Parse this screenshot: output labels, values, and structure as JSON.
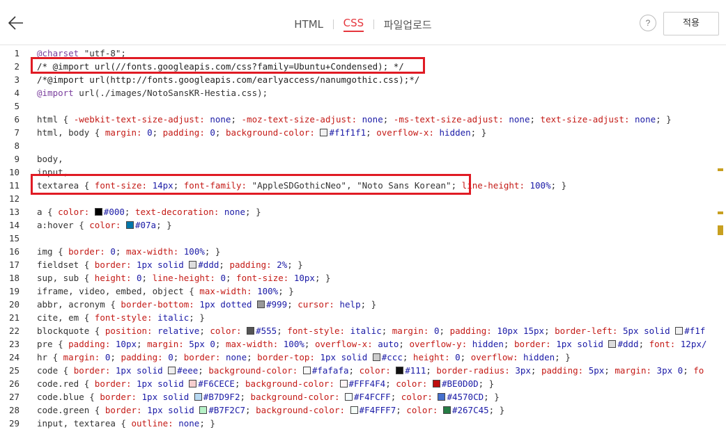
{
  "header": {
    "tabs": [
      {
        "label": "HTML",
        "active": false
      },
      {
        "label": "CSS",
        "active": true
      },
      {
        "label": "파일업로드",
        "active": false
      }
    ],
    "help_label": "?",
    "apply_label": "적용",
    "accent_color": "#e5363d"
  },
  "editor": {
    "lines": [
      {
        "n": "1",
        "segs": [
          [
            "at",
            "@charset "
          ],
          [
            "str",
            "\"utf-8\";"
          ]
        ]
      },
      {
        "n": "2",
        "segs": [
          [
            "cm",
            "/* @import url(//fonts.googleapis.com/css?family=Ubuntu+Condensed); */"
          ]
        ]
      },
      {
        "n": "3",
        "segs": [
          [
            "cm",
            "/*@import url(http://fonts.googleapis.com/earlyaccess/nanumgothic.css);*/"
          ]
        ]
      },
      {
        "n": "4",
        "segs": [
          [
            "at",
            "@import "
          ],
          [
            "sel",
            "url(./images/NotoSansKR-Hestia.css);"
          ]
        ]
      },
      {
        "n": "5",
        "segs": []
      },
      {
        "n": "6",
        "segs": [
          [
            "sel",
            "html { "
          ],
          [
            "prop",
            "-webkit-text-size-adjust: "
          ],
          [
            "val",
            "none"
          ],
          [
            "sel",
            "; "
          ],
          [
            "prop",
            "-moz-text-size-adjust: "
          ],
          [
            "val",
            "none"
          ],
          [
            "sel",
            "; "
          ],
          [
            "prop",
            "-ms-text-size-adjust: "
          ],
          [
            "val",
            "none"
          ],
          [
            "sel",
            "; "
          ],
          [
            "prop",
            "text-size-adjust: "
          ],
          [
            "val",
            "none"
          ],
          [
            "sel",
            "; }"
          ]
        ]
      },
      {
        "n": "7",
        "segs": [
          [
            "sel",
            "html, body { "
          ],
          [
            "prop",
            "margin: "
          ],
          [
            "val",
            "0"
          ],
          [
            "sel",
            "; "
          ],
          [
            "prop",
            "padding: "
          ],
          [
            "val",
            "0"
          ],
          [
            "sel",
            "; "
          ],
          [
            "prop",
            "background-color: "
          ],
          [
            "sw",
            "#f1f1f1"
          ],
          [
            "val",
            "#f1f1f1"
          ],
          [
            "sel",
            "; "
          ],
          [
            "prop",
            "overflow-x: "
          ],
          [
            "val",
            "hidden"
          ],
          [
            "sel",
            "; }"
          ]
        ]
      },
      {
        "n": "8",
        "segs": []
      },
      {
        "n": "9",
        "segs": [
          [
            "sel",
            "body,"
          ]
        ]
      },
      {
        "n": "10",
        "segs": [
          [
            "sel",
            "input,"
          ]
        ]
      },
      {
        "n": "11",
        "segs": [
          [
            "sel",
            "textarea { "
          ],
          [
            "prop",
            "font-size: "
          ],
          [
            "val",
            "14px"
          ],
          [
            "sel",
            "; "
          ],
          [
            "prop",
            "font-family: "
          ],
          [
            "str",
            "\"AppleSDGothicNeo\", \"Noto Sans Korean\""
          ],
          [
            "sel",
            "; "
          ],
          [
            "prop",
            "line-height: "
          ],
          [
            "val",
            "100%"
          ],
          [
            "sel",
            "; }"
          ]
        ]
      },
      {
        "n": "12",
        "segs": []
      },
      {
        "n": "13",
        "segs": [
          [
            "sel",
            "a { "
          ],
          [
            "prop",
            "color: "
          ],
          [
            "sw",
            "#000"
          ],
          [
            "val",
            "#000"
          ],
          [
            "sel",
            "; "
          ],
          [
            "prop",
            "text-decoration: "
          ],
          [
            "val",
            "none"
          ],
          [
            "sel",
            "; }"
          ]
        ]
      },
      {
        "n": "14",
        "segs": [
          [
            "sel",
            "a:hover { "
          ],
          [
            "prop",
            "color: "
          ],
          [
            "sw",
            "#07a"
          ],
          [
            "val",
            "#07a"
          ],
          [
            "sel",
            "; }"
          ]
        ]
      },
      {
        "n": "15",
        "segs": []
      },
      {
        "n": "16",
        "segs": [
          [
            "sel",
            "img { "
          ],
          [
            "prop",
            "border: "
          ],
          [
            "val",
            "0"
          ],
          [
            "sel",
            "; "
          ],
          [
            "prop",
            "max-width: "
          ],
          [
            "val",
            "100%"
          ],
          [
            "sel",
            "; }"
          ]
        ]
      },
      {
        "n": "17",
        "segs": [
          [
            "sel",
            "fieldset { "
          ],
          [
            "prop",
            "border: "
          ],
          [
            "val",
            "1px solid "
          ],
          [
            "sw",
            "#ddd"
          ],
          [
            "val",
            "#ddd"
          ],
          [
            "sel",
            "; "
          ],
          [
            "prop",
            "padding: "
          ],
          [
            "val",
            "2%"
          ],
          [
            "sel",
            "; }"
          ]
        ]
      },
      {
        "n": "18",
        "segs": [
          [
            "sel",
            "sup, sub { "
          ],
          [
            "prop",
            "height: "
          ],
          [
            "val",
            "0"
          ],
          [
            "sel",
            "; "
          ],
          [
            "prop",
            "line-height: "
          ],
          [
            "val",
            "0"
          ],
          [
            "sel",
            "; "
          ],
          [
            "prop",
            "font-size: "
          ],
          [
            "val",
            "10px"
          ],
          [
            "sel",
            "; }"
          ]
        ]
      },
      {
        "n": "19",
        "segs": [
          [
            "sel",
            "iframe, video, embed, object { "
          ],
          [
            "prop",
            "max-width: "
          ],
          [
            "val",
            "100%"
          ],
          [
            "sel",
            "; }"
          ]
        ]
      },
      {
        "n": "20",
        "segs": [
          [
            "sel",
            "abbr, acronym { "
          ],
          [
            "prop",
            "border-bottom: "
          ],
          [
            "val",
            "1px dotted "
          ],
          [
            "sw",
            "#999"
          ],
          [
            "val",
            "#999"
          ],
          [
            "sel",
            "; "
          ],
          [
            "prop",
            "cursor: "
          ],
          [
            "val",
            "help"
          ],
          [
            "sel",
            "; }"
          ]
        ]
      },
      {
        "n": "21",
        "segs": [
          [
            "sel",
            "cite, em { "
          ],
          [
            "prop",
            "font-style: "
          ],
          [
            "val",
            "italic"
          ],
          [
            "sel",
            "; }"
          ]
        ]
      },
      {
        "n": "22",
        "segs": [
          [
            "sel",
            "blockquote { "
          ],
          [
            "prop",
            "position: "
          ],
          [
            "val",
            "relative"
          ],
          [
            "sel",
            "; "
          ],
          [
            "prop",
            "color: "
          ],
          [
            "sw",
            "#555"
          ],
          [
            "val",
            "#555"
          ],
          [
            "sel",
            "; "
          ],
          [
            "prop",
            "font-style: "
          ],
          [
            "val",
            "italic"
          ],
          [
            "sel",
            "; "
          ],
          [
            "prop",
            "margin: "
          ],
          [
            "val",
            "0"
          ],
          [
            "sel",
            "; "
          ],
          [
            "prop",
            "padding: "
          ],
          [
            "val",
            "10px 15px"
          ],
          [
            "sel",
            "; "
          ],
          [
            "prop",
            "border-left: "
          ],
          [
            "val",
            "5px solid "
          ],
          [
            "sw",
            "#f1f1f1"
          ],
          [
            "val",
            "#f1f"
          ]
        ]
      },
      {
        "n": "23",
        "segs": [
          [
            "sel",
            "pre { "
          ],
          [
            "prop",
            "padding: "
          ],
          [
            "val",
            "10px"
          ],
          [
            "sel",
            "; "
          ],
          [
            "prop",
            "margin: "
          ],
          [
            "val",
            "5px 0"
          ],
          [
            "sel",
            "; "
          ],
          [
            "prop",
            "max-width: "
          ],
          [
            "val",
            "100%"
          ],
          [
            "sel",
            "; "
          ],
          [
            "prop",
            "overflow-x: "
          ],
          [
            "val",
            "auto"
          ],
          [
            "sel",
            "; "
          ],
          [
            "prop",
            "overflow-y: "
          ],
          [
            "val",
            "hidden"
          ],
          [
            "sel",
            "; "
          ],
          [
            "prop",
            "border: "
          ],
          [
            "val",
            "1px solid "
          ],
          [
            "sw",
            "#ddd"
          ],
          [
            "val",
            "#ddd"
          ],
          [
            "sel",
            "; "
          ],
          [
            "prop",
            "font: "
          ],
          [
            "val",
            "12px/"
          ]
        ]
      },
      {
        "n": "24",
        "segs": [
          [
            "sel",
            "hr { "
          ],
          [
            "prop",
            "margin: "
          ],
          [
            "val",
            "0"
          ],
          [
            "sel",
            "; "
          ],
          [
            "prop",
            "padding: "
          ],
          [
            "val",
            "0"
          ],
          [
            "sel",
            "; "
          ],
          [
            "prop",
            "border: "
          ],
          [
            "val",
            "none"
          ],
          [
            "sel",
            "; "
          ],
          [
            "prop",
            "border-top: "
          ],
          [
            "val",
            "1px solid "
          ],
          [
            "sw",
            "#ccc"
          ],
          [
            "val",
            "#ccc"
          ],
          [
            "sel",
            "; "
          ],
          [
            "prop",
            "height: "
          ],
          [
            "val",
            "0"
          ],
          [
            "sel",
            "; "
          ],
          [
            "prop",
            "overflow: "
          ],
          [
            "val",
            "hidden"
          ],
          [
            "sel",
            "; }"
          ]
        ]
      },
      {
        "n": "25",
        "segs": [
          [
            "sel",
            "code { "
          ],
          [
            "prop",
            "border: "
          ],
          [
            "val",
            "1px solid "
          ],
          [
            "sw",
            "#eee"
          ],
          [
            "val",
            "#eee"
          ],
          [
            "sel",
            "; "
          ],
          [
            "prop",
            "background-color: "
          ],
          [
            "sw",
            "#fafafa"
          ],
          [
            "val",
            "#fafafa"
          ],
          [
            "sel",
            "; "
          ],
          [
            "prop",
            "color: "
          ],
          [
            "sw",
            "#111"
          ],
          [
            "val",
            "#111"
          ],
          [
            "sel",
            "; "
          ],
          [
            "prop",
            "border-radius: "
          ],
          [
            "val",
            "3px"
          ],
          [
            "sel",
            "; "
          ],
          [
            "prop",
            "padding: "
          ],
          [
            "val",
            "5px"
          ],
          [
            "sel",
            "; "
          ],
          [
            "prop",
            "margin: "
          ],
          [
            "val",
            "3px 0"
          ],
          [
            "sel",
            "; "
          ],
          [
            "prop",
            "fo"
          ]
        ]
      },
      {
        "n": "26",
        "segs": [
          [
            "sel",
            "code.red { "
          ],
          [
            "prop",
            "border: "
          ],
          [
            "val",
            "1px solid "
          ],
          [
            "sw",
            "#F6CECE"
          ],
          [
            "val",
            "#F6CECE"
          ],
          [
            "sel",
            "; "
          ],
          [
            "prop",
            "background-color: "
          ],
          [
            "sw",
            "#FFF4F4"
          ],
          [
            "val",
            "#FFF4F4"
          ],
          [
            "sel",
            "; "
          ],
          [
            "prop",
            "color: "
          ],
          [
            "sw",
            "#BE0D0D"
          ],
          [
            "val",
            "#BE0D0D"
          ],
          [
            "sel",
            "; }"
          ]
        ]
      },
      {
        "n": "27",
        "segs": [
          [
            "sel",
            "code.blue { "
          ],
          [
            "prop",
            "border: "
          ],
          [
            "val",
            "1px solid "
          ],
          [
            "sw",
            "#B7D9F2"
          ],
          [
            "val",
            "#B7D9F2"
          ],
          [
            "sel",
            "; "
          ],
          [
            "prop",
            "background-color: "
          ],
          [
            "sw",
            "#F4FCFF"
          ],
          [
            "val",
            "#F4FCFF"
          ],
          [
            "sel",
            "; "
          ],
          [
            "prop",
            "color: "
          ],
          [
            "sw",
            "#4570CD"
          ],
          [
            "val",
            "#4570CD"
          ],
          [
            "sel",
            "; }"
          ]
        ]
      },
      {
        "n": "28",
        "segs": [
          [
            "sel",
            "code.green { "
          ],
          [
            "prop",
            "border: "
          ],
          [
            "val",
            "1px solid "
          ],
          [
            "sw",
            "#B7F2C7"
          ],
          [
            "val",
            "#B7F2C7"
          ],
          [
            "sel",
            "; "
          ],
          [
            "prop",
            "background-color: "
          ],
          [
            "sw",
            "#F4FFF7"
          ],
          [
            "val",
            "#F4FFF7"
          ],
          [
            "sel",
            "; "
          ],
          [
            "prop",
            "color: "
          ],
          [
            "sw",
            "#267C45"
          ],
          [
            "val",
            "#267C45"
          ],
          [
            "sel",
            "; }"
          ]
        ]
      },
      {
        "n": "29",
        "segs": [
          [
            "sel",
            "input, textarea { "
          ],
          [
            "prop",
            "outline: "
          ],
          [
            "val",
            "none"
          ],
          [
            "sel",
            "; }"
          ]
        ]
      }
    ]
  }
}
